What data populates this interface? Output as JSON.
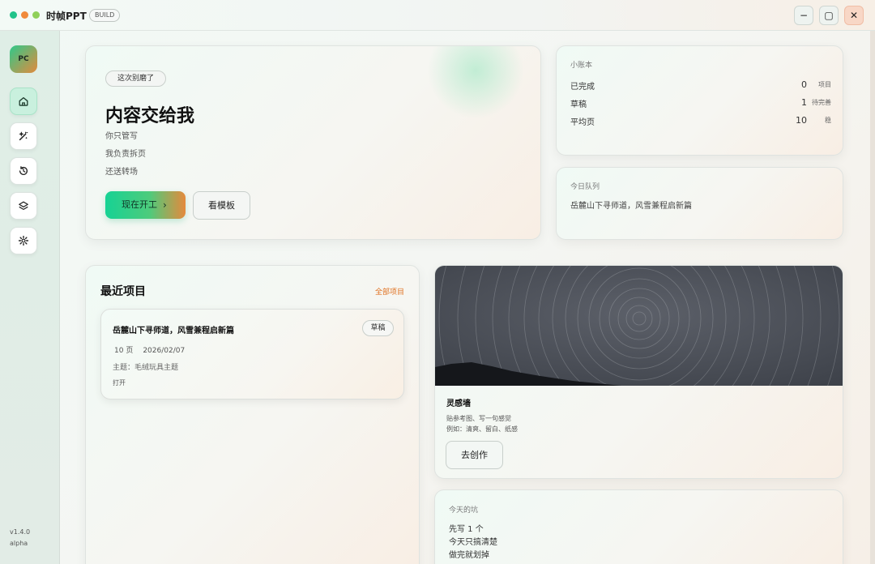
{
  "window": {
    "title": "时帧PPT",
    "badge": "BUILD",
    "minimize": "−",
    "maximize": "▢",
    "close": "✕"
  },
  "sidebar": {
    "avatar": "PC",
    "items": [
      {
        "icon": "home-icon",
        "active": true
      },
      {
        "icon": "magic-wand-icon",
        "active": false
      },
      {
        "icon": "history-icon",
        "active": false
      },
      {
        "icon": "layers-icon",
        "active": false
      },
      {
        "icon": "gear-icon",
        "active": false
      }
    ],
    "version": "v1.4.0",
    "channel": "alpha"
  },
  "hero": {
    "chip": "这次别磨了",
    "title": "内容交给我",
    "lines": [
      "你只管写",
      "我负责拆页",
      "还送转场"
    ],
    "primary_button": "现在开工",
    "primary_chevron": "›",
    "secondary_button": "看模板"
  },
  "stats": {
    "caption": "小账本",
    "rows": [
      {
        "label": "已完成",
        "value": "0",
        "unit": "项目"
      },
      {
        "label": "草稿",
        "value": "1",
        "unit": "待完善"
      },
      {
        "label": "平均页",
        "value": "10",
        "unit": "稳"
      }
    ]
  },
  "queue": {
    "caption": "今日队列",
    "item": "岳麓山下寻师道，风雪兼程启新篇"
  },
  "recent": {
    "title": "最近项目",
    "all_link": "全部项目",
    "project": {
      "title": "岳麓山下寻师道，风雪兼程启新篇",
      "status": "草稿",
      "pages": "10 页",
      "date": "2026/02/07",
      "theme": "主题：毛绒玩具主题",
      "open": "打开"
    }
  },
  "inspiration": {
    "title": "灵感墙",
    "lines": [
      "贴参考图、写一句感觉",
      "例如：清爽、留白、纸感"
    ],
    "button": "去创作"
  },
  "today": {
    "caption": "今天的坑",
    "lines": [
      "先写 1 个",
      "今天只搞清楚",
      "做完就划掉"
    ]
  },
  "colors": {
    "accent_green": "#16d294",
    "accent_orange": "#e58a3c",
    "link_orange": "#e0701f"
  }
}
